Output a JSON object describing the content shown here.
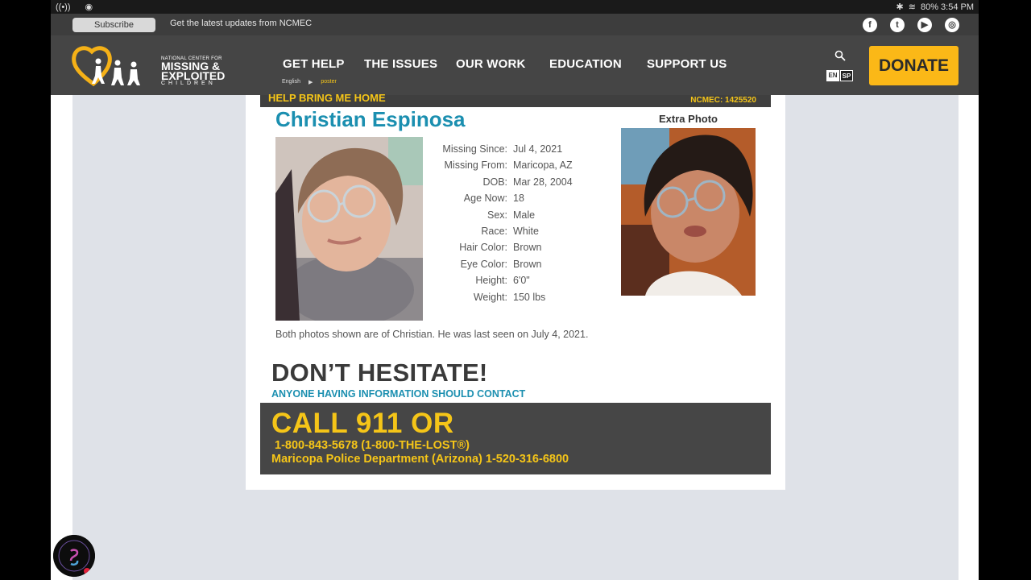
{
  "status_bar": {
    "right_text": "80%  3:54 PM"
  },
  "subscribe_bar": {
    "button_label": "Subscribe",
    "text": "Get the latest updates from NCMEC",
    "social": [
      "f",
      "t",
      "▶",
      "◎"
    ]
  },
  "nav": {
    "logo": {
      "line1": "NATIONAL CENTER FOR",
      "line2": "MISSING &",
      "line3": "EXPLOITED",
      "line4": "CHILDREN"
    },
    "items": [
      "GET HELP",
      "THE ISSUES",
      "OUR WORK",
      "EDUCATION",
      "SUPPORT US"
    ],
    "lang_sub": {
      "left": "English",
      "right": "poster"
    },
    "lang_toggle": {
      "en": "EN",
      "sp": "SP"
    },
    "donate_label": "DONATE"
  },
  "poster": {
    "header": "HELP BRING ME HOME",
    "ncmec_id": "NCMEC: 1425520",
    "name": "Christian Espinosa",
    "extra_photo_label": "Extra Photo",
    "details": [
      {
        "label": "Missing Since:",
        "value": "Jul 4, 2021"
      },
      {
        "label": "Missing From:",
        "value": "Maricopa, AZ"
      },
      {
        "label": "DOB:",
        "value": "Mar 28, 2004"
      },
      {
        "label": "Age Now:",
        "value": "18"
      },
      {
        "label": "Sex:",
        "value": "Male"
      },
      {
        "label": "Race:",
        "value": "White"
      },
      {
        "label": "Hair Color:",
        "value": "Brown"
      },
      {
        "label": "Eye Color:",
        "value": "Brown"
      },
      {
        "label": "Height:",
        "value": "6'0\""
      },
      {
        "label": "Weight:",
        "value": "150 lbs"
      }
    ],
    "caption": "Both photos shown are of Christian. He was last seen on July 4, 2021.",
    "dont_hesitate": "DON’T HESITATE!",
    "anyone": "ANYONE HAVING INFORMATION SHOULD CONTACT",
    "call": "CALL 911 OR",
    "phone1": "1-800-843-5678 (1-800-THE-LOST®)",
    "phone2": "Maricopa Police Department (Arizona) 1-520-316-6800"
  },
  "colors": {
    "accent_yellow": "#f5c518",
    "teal": "#1b8fb0",
    "dark_gray": "#454545"
  }
}
